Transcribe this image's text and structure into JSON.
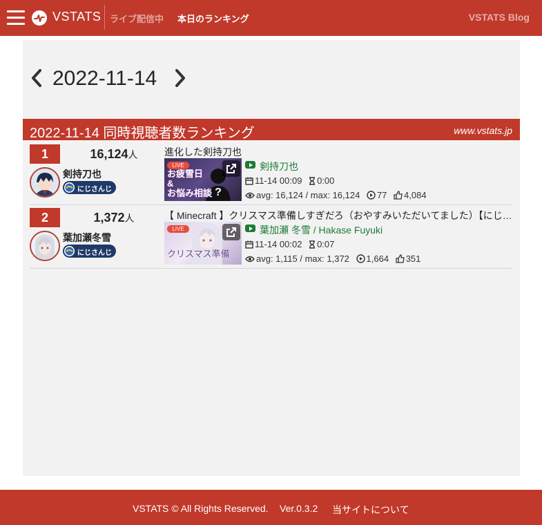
{
  "navbar": {
    "brand": "VSTATS",
    "live_link": "ライブ配信中",
    "today_ranking_link": "本日のランキング",
    "blog_link": "VSTATS Blog",
    "color": "#c0392b"
  },
  "date_nav": {
    "date": "2022-11-14",
    "prev_icon": "chevron-left-icon",
    "next_icon": "chevron-right-icon"
  },
  "ranking_header": {
    "title": "2022-11-14 同時視聴者数ランキング",
    "site": "www.vstats.jp"
  },
  "rankings": [
    {
      "rank": "1",
      "viewers": "16,124",
      "unit": "人",
      "streamer": "剣持刀也",
      "org": "にじさんじ",
      "video_title": "進化した剣持刀也",
      "live_tag": "LIVE",
      "thumb_caption": "お疲雪日\n&\nお悩み相談",
      "channel": "剣持刀也",
      "start_time": "11-14 00:09",
      "duration": "0:00",
      "avg_max": "avg: 16,124 / max: 16,124",
      "plays": "77",
      "likes": "4,084"
    },
    {
      "rank": "2",
      "viewers": "1,372",
      "unit": "人",
      "streamer": "葉加瀬冬雪",
      "org": "にじさんじ",
      "video_title": "【 Minecraft 】クリスマス準備しすぎだろ（おやすみいただいてました）【にじさんじ/葉加瀬冬雪】",
      "live_tag": "LIVE",
      "thumb_caption": "クリスマス準備",
      "channel": "葉加瀬 冬雪 / Hakase Fuyuki",
      "start_time": "11-14 00:02",
      "duration": "0:07",
      "avg_max": "avg: 1,115 / max: 1,372",
      "plays": "1,664",
      "likes": "351"
    }
  ],
  "footer": {
    "copyright": "VSTATS © All Rights Reserved.",
    "version": "Ver.0.3.2",
    "about": "当サイトについて"
  }
}
